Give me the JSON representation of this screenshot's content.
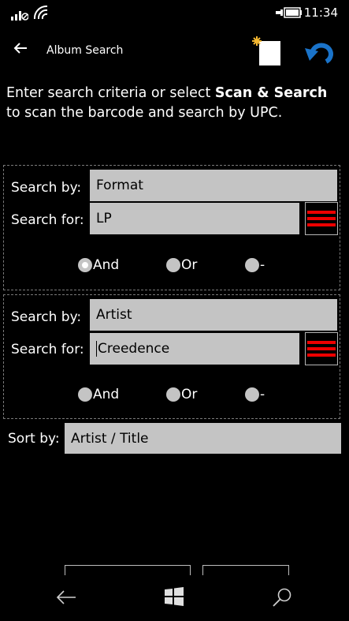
{
  "status_bar": {
    "time": "11:34"
  },
  "header": {
    "title": "Album Search"
  },
  "intro": {
    "text_before": "Enter search criteria or select ",
    "bold": "Scan & Search",
    "text_after": " to scan the barcode and search by UPC."
  },
  "criteria": [
    {
      "search_by_label": "Search by:",
      "search_by_value": "Format",
      "search_for_label": "Search for:",
      "search_for_value": "LP",
      "options": [
        "And",
        "Or",
        "-"
      ],
      "selected": "And"
    },
    {
      "search_by_label": "Search by:",
      "search_by_value": "Artist",
      "search_for_label": "Search for:",
      "search_for_value": "Creedence",
      "options": [
        "And",
        "Or",
        "-"
      ],
      "selected": ""
    }
  ],
  "sort": {
    "label": "Sort by:",
    "value": "Artist / Title"
  },
  "colors": {
    "field_bg": "#c4c4c4",
    "accent_blue": "#1a73c9",
    "stripe_red": "#e00000"
  }
}
